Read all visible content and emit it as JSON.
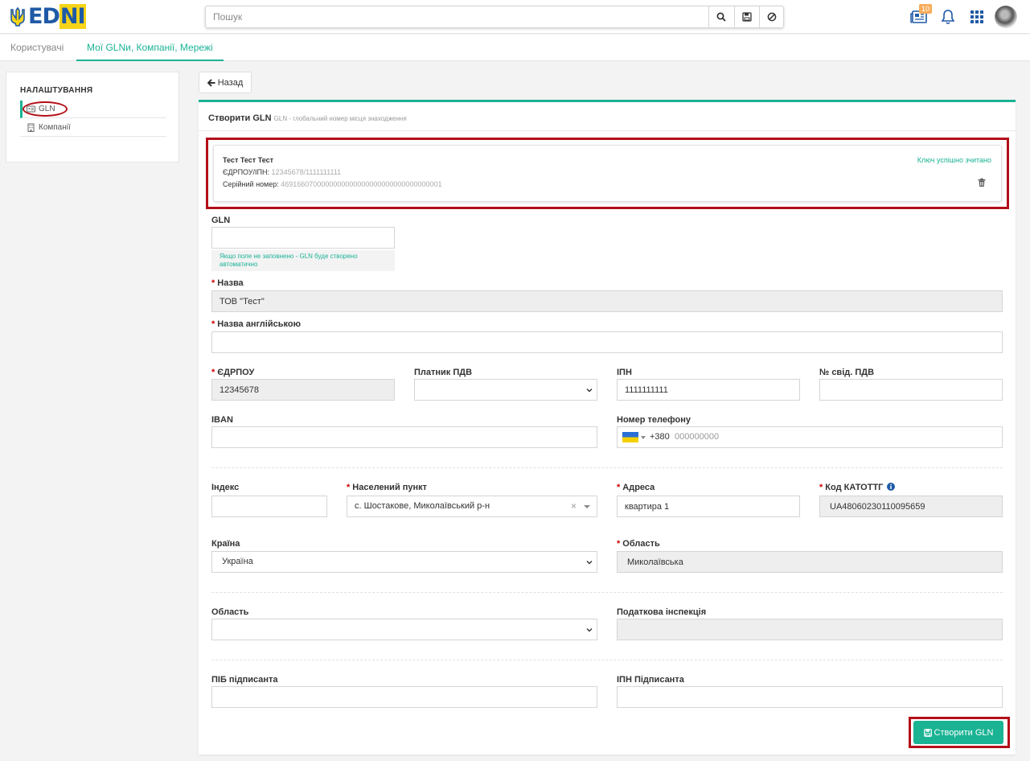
{
  "header": {
    "logo_text": "EDNI",
    "search_placeholder": "Пошук",
    "notification_count": "10"
  },
  "tabs": [
    {
      "label": "Користувачі",
      "active": false
    },
    {
      "label": "Мої GLNи, Компанії, Мережі",
      "active": true
    }
  ],
  "sidebar": {
    "heading": "НАЛАШТУВАННЯ",
    "items": [
      {
        "label": "GLN",
        "icon": "id-card-icon",
        "active": true
      },
      {
        "label": "Компанії",
        "icon": "building-icon",
        "active": false
      }
    ]
  },
  "back_label": "Назад",
  "panel": {
    "title": "Створити GLN",
    "subtitle": "GLN - глобальний номер місця знаходження"
  },
  "key": {
    "name": "Тест Тест Тест",
    "edrpou_label": "ЄДРПОУ/ІПН:",
    "edrpou_value": "12345678/1111111111",
    "serial_label": "Серійний номер:",
    "serial_value": "4691660700000000000000000000000000000001",
    "status": "Ключ успішно зчитано"
  },
  "form": {
    "gln": {
      "label": "GLN",
      "value": "",
      "hint": "Якщо поле не заповнено - GLN буде створено автоматично"
    },
    "name": {
      "label": "Назва",
      "value": "ТОВ \"Тест\""
    },
    "name_en": {
      "label": "Назва англійською",
      "value": ""
    },
    "edrpou": {
      "label": "ЄДРПОУ",
      "value": "12345678"
    },
    "vat_payer": {
      "label": "Платник ПДВ",
      "value": ""
    },
    "ipn": {
      "label": "ІПН",
      "value": "1111111111"
    },
    "vat_cert": {
      "label": "№ свід. ПДВ",
      "value": ""
    },
    "iban": {
      "label": "IBAN",
      "value": ""
    },
    "phone": {
      "label": "Номер телефону",
      "code": "+380",
      "placeholder": "000000000"
    },
    "index": {
      "label": "Індекс",
      "value": ""
    },
    "settlement": {
      "label": "Населений пункт",
      "value": "с. Шостакове, Миколаївський р-н"
    },
    "address": {
      "label": "Адреса",
      "value": "квартира 1"
    },
    "katottg": {
      "label": "Код КАТОТТГ",
      "value": "UA48060230110095659"
    },
    "country": {
      "label": "Країна",
      "value": "Україна"
    },
    "region_ro": {
      "label": "Область",
      "value": "Миколаївська"
    },
    "region": {
      "label": "Область",
      "value": ""
    },
    "tax_office": {
      "label": "Податкова інспекція",
      "value": ""
    },
    "signer_name": {
      "label": "ПІБ підписанта",
      "value": ""
    },
    "signer_ipn": {
      "label": "ІПН Підписанта",
      "value": ""
    }
  },
  "create_label": "Створити GLN",
  "colors": {
    "accent": "#1ab394",
    "highlight": "#b30f18",
    "brand_blue": "#1f5aa6",
    "brand_yellow": "#f7d417"
  }
}
